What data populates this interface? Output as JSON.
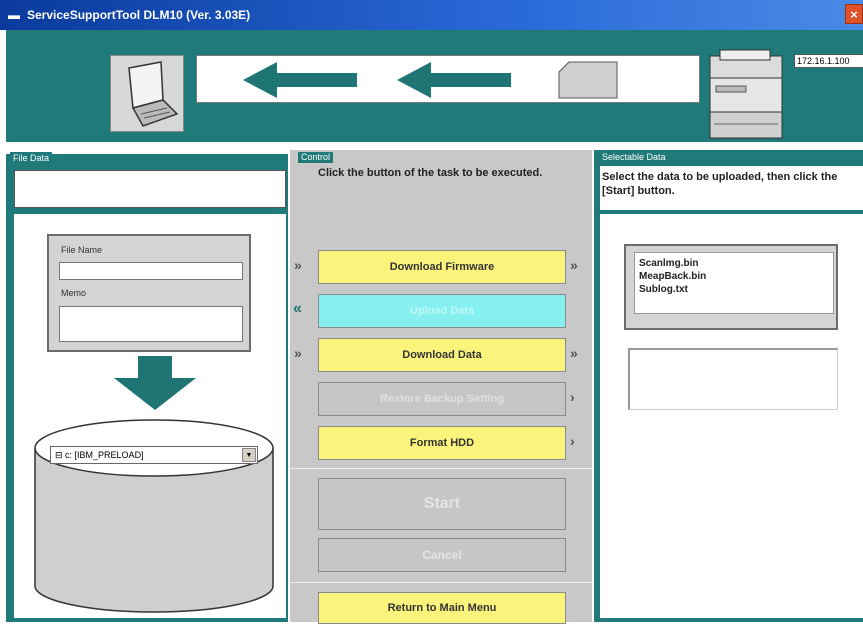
{
  "window": {
    "title": "ServiceSupportTool DLM10 (Ver. 3.03E)",
    "close_label": "×"
  },
  "banner": {
    "ip_address": "172.16.1.100"
  },
  "left_panel": {
    "group_label": "File Data",
    "file_name_label": "File Name",
    "file_name_value": "",
    "memo_label": "Memo",
    "memo_value": "",
    "drive_selected": "⊟ c: [IBM_PRELOAD]"
  },
  "center_panel": {
    "group_label": "Control",
    "instruction": "Click the button of the task to be executed.",
    "buttons": {
      "download_firmware": "Download Firmware",
      "upload_data": "Upload Data",
      "download_data": "Download Data",
      "restore_backup": "Restore Backup Setting",
      "format_hdd": "Format HDD",
      "start": "Start",
      "cancel": "Cancel",
      "return_main": "Return to Main Menu"
    }
  },
  "right_panel": {
    "group_label": "Selectable Data",
    "instruction": "Select the data to be uploaded, then click the [Start] button.",
    "data_items": [
      "Scanlmg.bin",
      "MeapBack.bin",
      "Sublog.txt"
    ]
  },
  "colors": {
    "teal": "#207a7a",
    "yellow": "#fbf47c",
    "cyan": "#86f0f0",
    "titlebar": "#0a3a9c"
  }
}
